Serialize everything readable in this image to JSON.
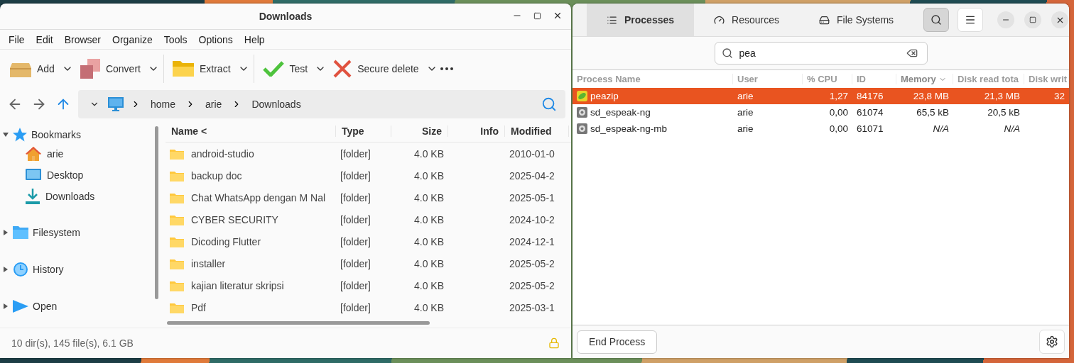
{
  "file_manager": {
    "title": "Downloads",
    "menu": [
      "File",
      "Edit",
      "Browser",
      "Organize",
      "Tools",
      "Options",
      "Help"
    ],
    "toolbar": [
      {
        "label": "Add"
      },
      {
        "label": "Convert"
      },
      {
        "label": "Extract"
      },
      {
        "label": "Test"
      },
      {
        "label": "Secure delete"
      }
    ],
    "path": [
      "home",
      "arie",
      "Downloads"
    ],
    "sidebar": [
      {
        "label": "Bookmarks",
        "expanded": true,
        "children": [
          {
            "label": "arie"
          },
          {
            "label": "Desktop"
          },
          {
            "label": "Downloads"
          }
        ]
      },
      {
        "label": "Filesystem",
        "expanded": false
      },
      {
        "label": "History",
        "expanded": false
      },
      {
        "label": "Open",
        "expanded": false
      }
    ],
    "columns": [
      "Name <",
      "Type",
      "Size",
      "Info",
      "Modified"
    ],
    "rows": [
      {
        "name": "android-studio",
        "type": "[folder]",
        "size": "4.0 KB",
        "modified": "2010-01-0"
      },
      {
        "name": "backup doc",
        "type": "[folder]",
        "size": "4.0 KB",
        "modified": "2025-04-2"
      },
      {
        "name": "Chat WhatsApp dengan M Nal",
        "type": "[folder]",
        "size": "4.0 KB",
        "modified": "2025-05-1"
      },
      {
        "name": "CYBER SECURITY",
        "type": "[folder]",
        "size": "4.0 KB",
        "modified": "2024-10-2"
      },
      {
        "name": "Dicoding Flutter",
        "type": "[folder]",
        "size": "4.0 KB",
        "modified": "2024-12-1"
      },
      {
        "name": "installer",
        "type": "[folder]",
        "size": "4.0 KB",
        "modified": "2025-05-2"
      },
      {
        "name": "kajian literatur skripsi",
        "type": "[folder]",
        "size": "4.0 KB",
        "modified": "2025-05-2"
      },
      {
        "name": "Pdf",
        "type": "[folder]",
        "size": "4.0 KB",
        "modified": "2025-03-1"
      }
    ],
    "status": "10 dir(s), 145 file(s), 6.1 GB"
  },
  "system_monitor": {
    "tabs": [
      {
        "label": "Processes",
        "selected": true
      },
      {
        "label": "Resources",
        "selected": false
      },
      {
        "label": "File Systems",
        "selected": false
      }
    ],
    "search_button": {
      "pressed": true
    },
    "search": {
      "value": "pea"
    },
    "columns": [
      {
        "label": "Process Name",
        "sorted": false
      },
      {
        "label": "User",
        "sorted": false
      },
      {
        "label": "% CPU",
        "sorted": false
      },
      {
        "label": "ID",
        "sorted": false
      },
      {
        "label": "Memory",
        "sorted": true
      },
      {
        "label": "Disk read tota",
        "sorted": false
      },
      {
        "label": "Disk writ",
        "sorted": false
      }
    ],
    "rows": [
      {
        "name": "peazip",
        "user": "arie",
        "cpu": "1,27",
        "id": "84176",
        "memory": "23,8 MB",
        "disk_read": "21,3 MB",
        "disk_write": "32",
        "available": true,
        "selected": true
      },
      {
        "name": "sd_espeak-ng",
        "user": "arie",
        "cpu": "0,00",
        "id": "61074",
        "memory": "65,5 kB",
        "disk_read": "20,5 kB",
        "available": true,
        "selected": false
      },
      {
        "name": "sd_espeak-ng-mb",
        "user": "arie",
        "cpu": "0,00",
        "id": "61071",
        "memory": "N/A",
        "disk_read": "N/A",
        "available": false,
        "selected": false
      }
    ],
    "end_button": "End Process"
  }
}
